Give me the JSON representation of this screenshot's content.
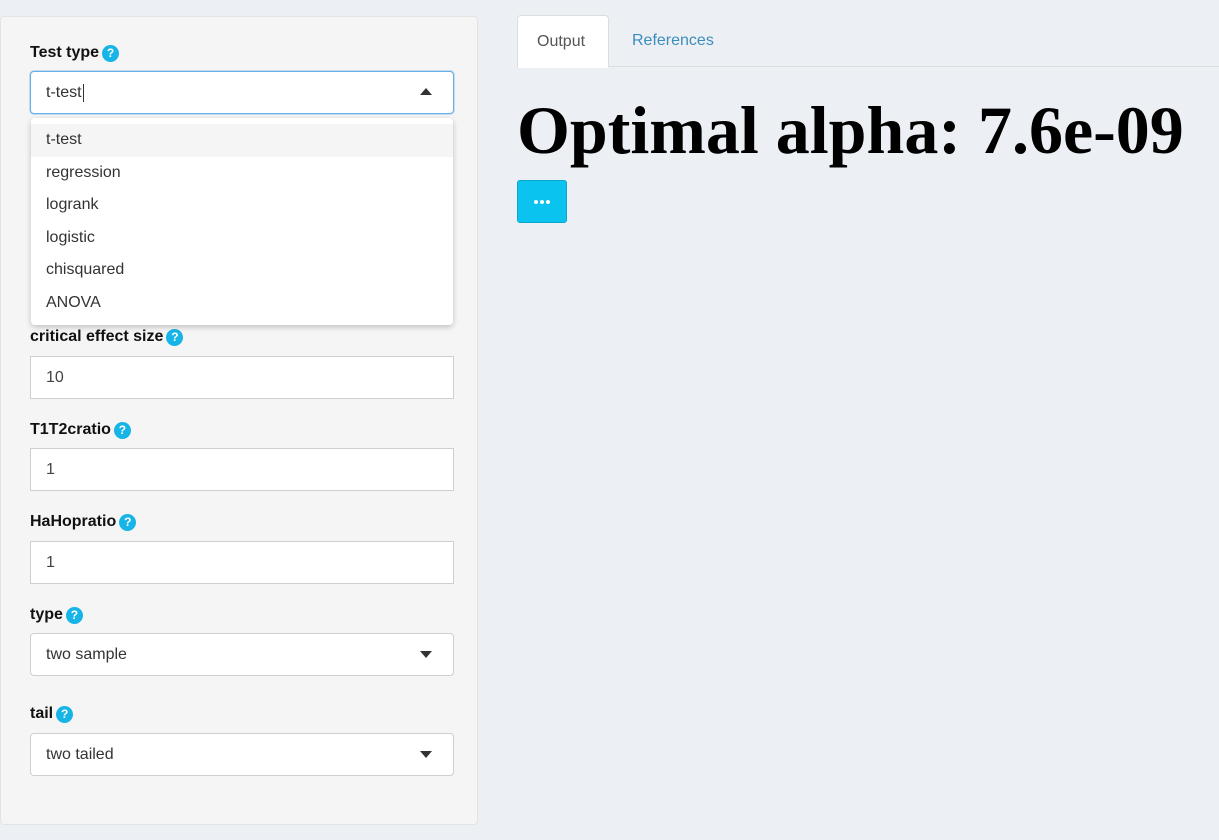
{
  "sidebar": {
    "test_type": {
      "label": "Test type",
      "value": "t-test",
      "options": [
        "t-test",
        "regression",
        "logrank",
        "logistic",
        "chisquared",
        "ANOVA"
      ]
    },
    "critical_effect_size": {
      "label": "critical effect size",
      "value": "10"
    },
    "t1t2ratio": {
      "label": "T1T2cratio",
      "value": "1"
    },
    "hahopratio": {
      "label": "HaHopratio",
      "value": "1"
    },
    "type": {
      "label": "type",
      "value": "two sample"
    },
    "tail": {
      "label": "tail",
      "value": "two tailed"
    }
  },
  "help_glyph": "?",
  "tabs": [
    "Output",
    "References"
  ],
  "main": {
    "result": "Optimal alpha: 7.6e-09"
  },
  "icons": {
    "help": "help-icon",
    "more": "more-horizontal-icon",
    "caret_up": "caret-up-icon",
    "caret_down": "caret-down-icon"
  },
  "colors": {
    "accent": "#17b4e8",
    "button": "#0ac3ee",
    "link": "#3c8dbc",
    "background": "#ecf0f5"
  }
}
